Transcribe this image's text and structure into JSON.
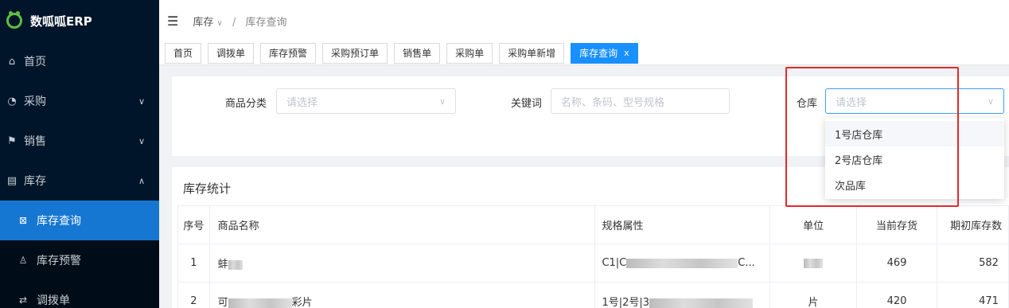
{
  "app": {
    "title": "数呱呱ERP"
  },
  "sidebar": {
    "items": [
      {
        "label": "首页",
        "icon": "home-icon"
      },
      {
        "label": "采购",
        "icon": "purchase-icon",
        "chevron": "∨"
      },
      {
        "label": "销售",
        "icon": "flag-icon",
        "chevron": "∨"
      },
      {
        "label": "库存",
        "icon": "warehouse-icon",
        "chevron": "∧"
      }
    ],
    "sub_items": [
      {
        "label": "库存查询",
        "icon": "grid-icon"
      },
      {
        "label": "库存预警",
        "icon": "bell-icon"
      },
      {
        "label": "调拨单",
        "icon": "transfer-icon"
      }
    ]
  },
  "header": {
    "breadcrumb": [
      "库存",
      "库存查询"
    ]
  },
  "tabs": [
    {
      "label": "首页"
    },
    {
      "label": "调拨单"
    },
    {
      "label": "库存预警"
    },
    {
      "label": "采购预订单"
    },
    {
      "label": "销售单"
    },
    {
      "label": "采购单"
    },
    {
      "label": "采购单新增"
    },
    {
      "label": "库存查询",
      "close": "x"
    }
  ],
  "filters": {
    "category_label": "商品分类",
    "category_placeholder": "请选择",
    "keyword_label": "关键词",
    "keyword_placeholder": "名称、条码、型号规格",
    "warehouse_label": "仓库",
    "warehouse_placeholder": "请选择"
  },
  "warehouse_options": [
    "1号店仓库",
    "2号店仓库",
    "次品库"
  ],
  "table": {
    "title": "库存统计",
    "columns": [
      "序号",
      "商品名称",
      "规格属性",
      "单位",
      "当前存货",
      "期初库存数"
    ],
    "rows": [
      {
        "no": "1",
        "name": "蚌",
        "spec": "C1|C",
        "spec_tail": "C...",
        "unit": "",
        "stock": "469",
        "initial": "582"
      },
      {
        "no": "2",
        "name": "可",
        "name_tail": "彩片",
        "spec": "1号|2号|3",
        "unit": "片",
        "stock": "420",
        "initial": "471"
      }
    ]
  },
  "colors": {
    "sidebar_bg": "#001529",
    "active": "#1677d2",
    "tab_active": "#1890ff",
    "annotation": "#e3282a"
  }
}
